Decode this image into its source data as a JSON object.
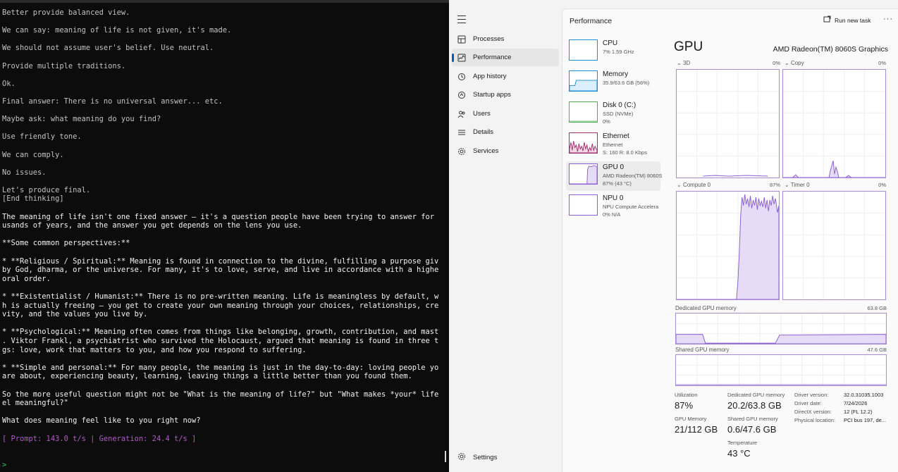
{
  "terminal": {
    "lines": [
      {
        "text": "Better provide balanced view.",
        "style": "think"
      },
      {
        "text": "",
        "style": "think"
      },
      {
        "text": "We can say: meaning of life is not given, it's made.",
        "style": "think"
      },
      {
        "text": "",
        "style": "think"
      },
      {
        "text": "We should not assume user's belief. Use neutral.",
        "style": "think"
      },
      {
        "text": "",
        "style": "think"
      },
      {
        "text": "Provide multiple traditions.",
        "style": "think"
      },
      {
        "text": "",
        "style": "think"
      },
      {
        "text": "Ok.",
        "style": "think"
      },
      {
        "text": "",
        "style": "think"
      },
      {
        "text": "Final answer: There is no universal answer... etc.",
        "style": "think"
      },
      {
        "text": "",
        "style": "think"
      },
      {
        "text": "Maybe ask: what meaning do you find?",
        "style": "think"
      },
      {
        "text": "",
        "style": "think"
      },
      {
        "text": "Use friendly tone.",
        "style": "think"
      },
      {
        "text": "",
        "style": "think"
      },
      {
        "text": "We can comply.",
        "style": "think"
      },
      {
        "text": "",
        "style": "think"
      },
      {
        "text": "No issues.",
        "style": "think"
      },
      {
        "text": "",
        "style": "think"
      },
      {
        "text": "Let's produce final.",
        "style": "think"
      },
      {
        "text": "[End thinking]",
        "style": "think"
      },
      {
        "text": "",
        "style": "ans"
      },
      {
        "text": "The meaning of life isn't one fixed answer — it's a question people have been trying to answer for tho",
        "style": "ans"
      },
      {
        "text": "usands of years, and the answer you get depends on the lens you use.",
        "style": "ans"
      },
      {
        "text": "",
        "style": "ans"
      },
      {
        "text": "**Some common perspectives:**",
        "style": "ans"
      },
      {
        "text": "",
        "style": "ans"
      },
      {
        "text": "* **Religious / Spiritual:** Meaning is found in connection to the divine, fulfilling a purpose given",
        "style": "ans"
      },
      {
        "text": "by God, dharma, or the universe. For many, it's to love, serve, and live in accordance with a higher m",
        "style": "ans"
      },
      {
        "text": "oral order.",
        "style": "ans"
      },
      {
        "text": "",
        "style": "ans"
      },
      {
        "text": "* **Existentialist / Humanist:** There is no pre-written meaning. Life is meaningless by default, whic",
        "style": "ans"
      },
      {
        "text": "h is actually freeing — you get to create your own meaning through your choices, relationships, creati",
        "style": "ans"
      },
      {
        "text": "vity, and the values you live by.",
        "style": "ans"
      },
      {
        "text": "",
        "style": "ans"
      },
      {
        "text": "* **Psychological:** Meaning often comes from things like belonging, growth, contribution, and mastery",
        "style": "ans"
      },
      {
        "text": ". Viktor Frankl, a psychiatrist who survived the Holocaust, argued that meaning is found in three thin",
        "style": "ans"
      },
      {
        "text": "gs: love, work that matters to you, and how you respond to suffering.",
        "style": "ans"
      },
      {
        "text": "",
        "style": "ans"
      },
      {
        "text": "* **Simple and personal:** For many people, the meaning is just in the day-to-day: loving people you c",
        "style": "ans"
      },
      {
        "text": "are about, experiencing beauty, learning, leaving things a little better than you found them.",
        "style": "ans"
      },
      {
        "text": "",
        "style": "ans"
      },
      {
        "text": "So the more useful question might not be \"What is the meaning of life?\" but \"What makes *your* life fe",
        "style": "ans"
      },
      {
        "text": "el meaningful?\"",
        "style": "ans"
      },
      {
        "text": "",
        "style": "ans"
      },
      {
        "text": "What does meaning feel like to you right now?",
        "style": "ans"
      },
      {
        "text": "",
        "style": "ans"
      },
      {
        "text": "[ Prompt: 143.0 t/s | Generation: 24.4 t/s ]",
        "style": "stats"
      },
      {
        "text": "",
        "style": "ans"
      },
      {
        "text": "",
        "style": "ans"
      },
      {
        "text": ">",
        "style": "prompt"
      }
    ]
  },
  "taskmanager": {
    "title": "Performance",
    "run_new_task": "Run new task",
    "more": "···",
    "nav": [
      {
        "label": "Processes",
        "icon": "processes-icon"
      },
      {
        "label": "Performance",
        "icon": "performance-icon",
        "active": true
      },
      {
        "label": "App history",
        "icon": "app-history-icon"
      },
      {
        "label": "Startup apps",
        "icon": "startup-apps-icon"
      },
      {
        "label": "Users",
        "icon": "users-icon"
      },
      {
        "label": "Details",
        "icon": "details-icon"
      },
      {
        "label": "Services",
        "icon": "services-icon"
      }
    ],
    "settings_label": "Settings",
    "resources": [
      {
        "title": "CPU",
        "sub": [
          "7%  1.59 GHz"
        ],
        "color": "#1b8fd6"
      },
      {
        "title": "Memory",
        "sub": [
          "35.9/63.6 GB (56%)"
        ],
        "color": "#1b8fd6",
        "level": 0.56
      },
      {
        "title": "Disk 0 (C:)",
        "sub": [
          "SSD (NVMe)",
          "0%"
        ],
        "color": "#4caf50"
      },
      {
        "title": "Ethernet",
        "sub": [
          "Ethernet",
          "S: 160  R: 8.0 Kbps"
        ],
        "color": "#a0306e"
      },
      {
        "title": "GPU 0",
        "sub": [
          "AMD Radeon(TM) 8060S",
          "87%  (43 °C)"
        ],
        "color": "#8e5fd6",
        "active": true
      },
      {
        "title": "NPU 0",
        "sub": [
          "NPU Compute Accelera",
          "0%  N/A"
        ],
        "color": "#8e5fd6"
      }
    ],
    "gpu": {
      "heading": "GPU",
      "name": "AMD Radeon(TM) 8060S Graphics",
      "graphs": [
        {
          "label": "3D",
          "pct": "0%"
        },
        {
          "label": "Copy",
          "pct": "0%"
        },
        {
          "label": "Compute 0",
          "pct": "87%"
        },
        {
          "label": "Timer 0",
          "pct": "0%"
        }
      ],
      "dedicated_label": "Dedicated GPU memory",
      "dedicated_max": "63.8 GB",
      "shared_label": "Shared GPU memory",
      "shared_max": "47.6 GB",
      "stats": {
        "utilization_label": "Utilization",
        "utilization": "87%",
        "dedicated_label": "Dedicated GPU memory",
        "dedicated": "20.2/63.8 GB",
        "gpu_memory_label": "GPU Memory",
        "gpu_memory": "21/112 GB",
        "shared_label": "Shared GPU memory",
        "shared": "0.6/47.6 GB",
        "temperature_label": "Temperature",
        "temperature": "43 °C"
      },
      "driver": [
        {
          "k": "Driver version:",
          "v": "32.0.31035.1003"
        },
        {
          "k": "Driver date:",
          "v": "7/24/2026"
        },
        {
          "k": "DirectX version:",
          "v": "12 (FL 12.2)"
        },
        {
          "k": "Physical location:",
          "v": "PCI bus 197, de..."
        }
      ]
    }
  }
}
